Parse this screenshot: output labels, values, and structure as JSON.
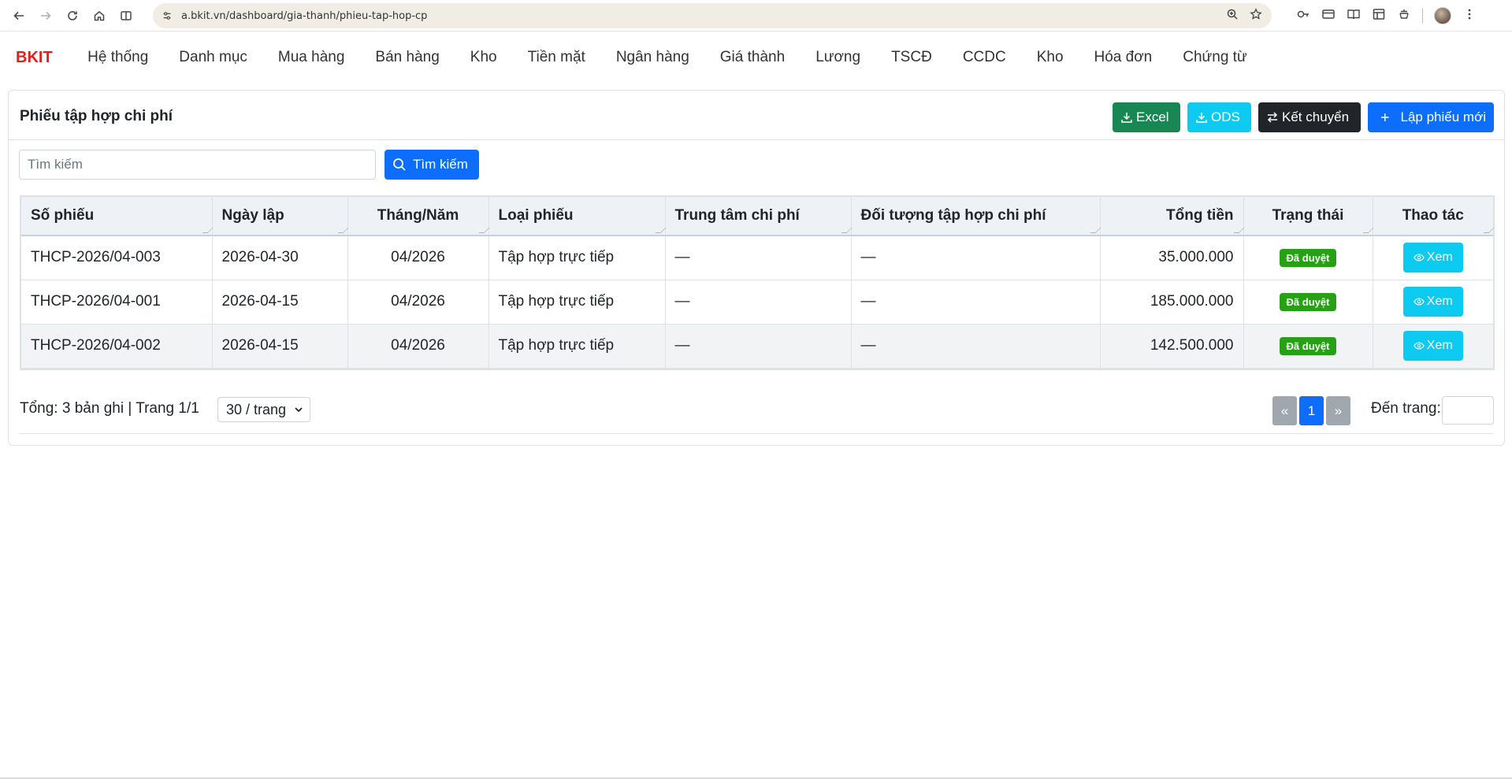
{
  "browser": {
    "url": "a.bkit.vn/dashboard/gia-thanh/phieu-tap-hop-cp"
  },
  "app": {
    "brand": "BKIT",
    "menu": [
      "Hệ thống",
      "Danh mục",
      "Mua hàng",
      "Bán hàng",
      "Kho",
      "Tiền mặt",
      "Ngân hàng",
      "Giá thành",
      "Lương",
      "TSCĐ",
      "CCDC",
      "Kho",
      "Hóa đơn",
      "Chứng từ"
    ]
  },
  "page": {
    "title": "Phiếu tập hợp chi phí",
    "actions": {
      "excel": "Excel",
      "ods": "ODS",
      "ket_chuyen": "Kết chuyển",
      "lap_phieu_moi": "Lập phiếu mới"
    },
    "search": {
      "placeholder": "Tìm kiếm",
      "button": "Tìm kiếm"
    },
    "table": {
      "columns": [
        "Số phiếu",
        "Ngày lập",
        "Tháng/Năm",
        "Loại phiếu",
        "Trung tâm chi phí",
        "Đối tượng tập hợp chi phí",
        "Tổng tiền",
        "Trạng thái",
        "Thao tác"
      ],
      "rows": [
        {
          "so_phieu": "THCP-2026/04-003",
          "ngay_lap": "2026-04-30",
          "thang_nam": "04/2026",
          "loai_phieu": "Tập hợp trực tiếp",
          "trung_tam": "—",
          "doi_tuong": "—",
          "tong_tien": "35.000.000",
          "trang_thai": "Đã duyệt",
          "thao_tac": "Xem"
        },
        {
          "so_phieu": "THCP-2026/04-001",
          "ngay_lap": "2026-04-15",
          "thang_nam": "04/2026",
          "loai_phieu": "Tập hợp trực tiếp",
          "trung_tam": "—",
          "doi_tuong": "—",
          "tong_tien": "185.000.000",
          "trang_thai": "Đã duyệt",
          "thao_tac": "Xem"
        },
        {
          "so_phieu": "THCP-2026/04-002",
          "ngay_lap": "2026-04-15",
          "thang_nam": "04/2026",
          "loai_phieu": "Tập hợp trực tiếp",
          "trung_tam": "—",
          "doi_tuong": "—",
          "tong_tien": "142.500.000",
          "trang_thai": "Đã duyệt",
          "thao_tac": "Xem"
        }
      ]
    },
    "footer": {
      "summary": "Tổng: 3 bản ghi | Trang 1/1",
      "per_page": "30 / trang",
      "prev": "«",
      "current_page": "1",
      "next": "»",
      "goto_label": "Đến trang:"
    }
  }
}
